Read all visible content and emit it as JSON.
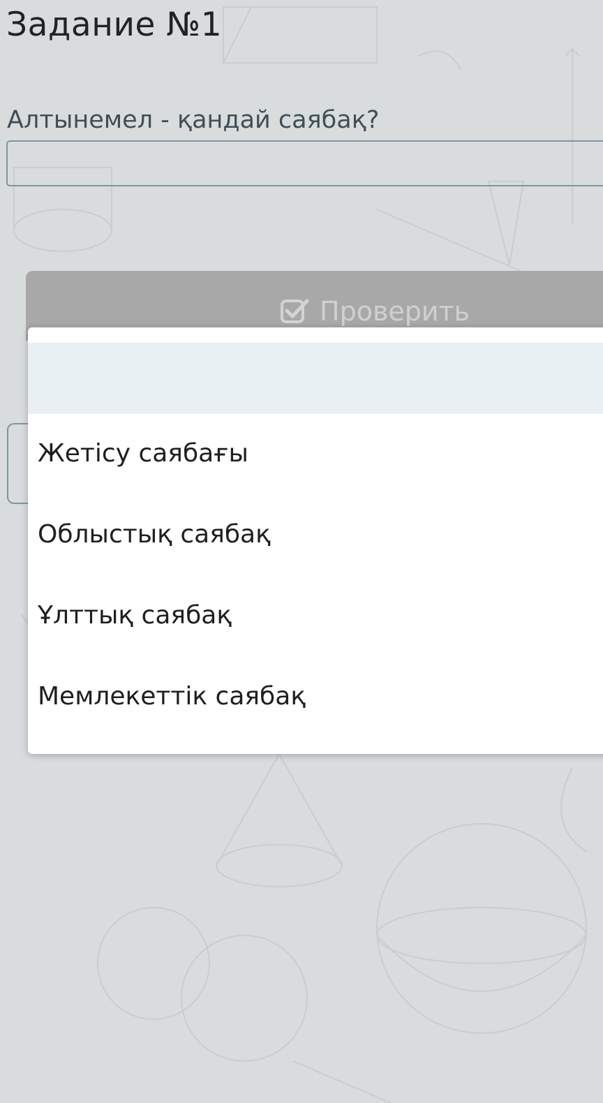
{
  "task": {
    "title": "Задание №1"
  },
  "question": {
    "label": "Алтынемел - қандай саябақ?",
    "selected_value": ""
  },
  "check_button": {
    "label": "Проверить",
    "icon": "check-square-icon"
  },
  "dropdown": {
    "empty_option": "",
    "options": [
      "Жетісу саябағы",
      "Облыстық саябақ",
      "Ұлттық саябақ",
      "Мемлекеттік саябақ"
    ]
  },
  "colors": {
    "page_background": "#d9dcdd",
    "button_background": "#a8a8a8",
    "field_border": "#7d979f",
    "highlight_option": "#e8f0f3"
  }
}
